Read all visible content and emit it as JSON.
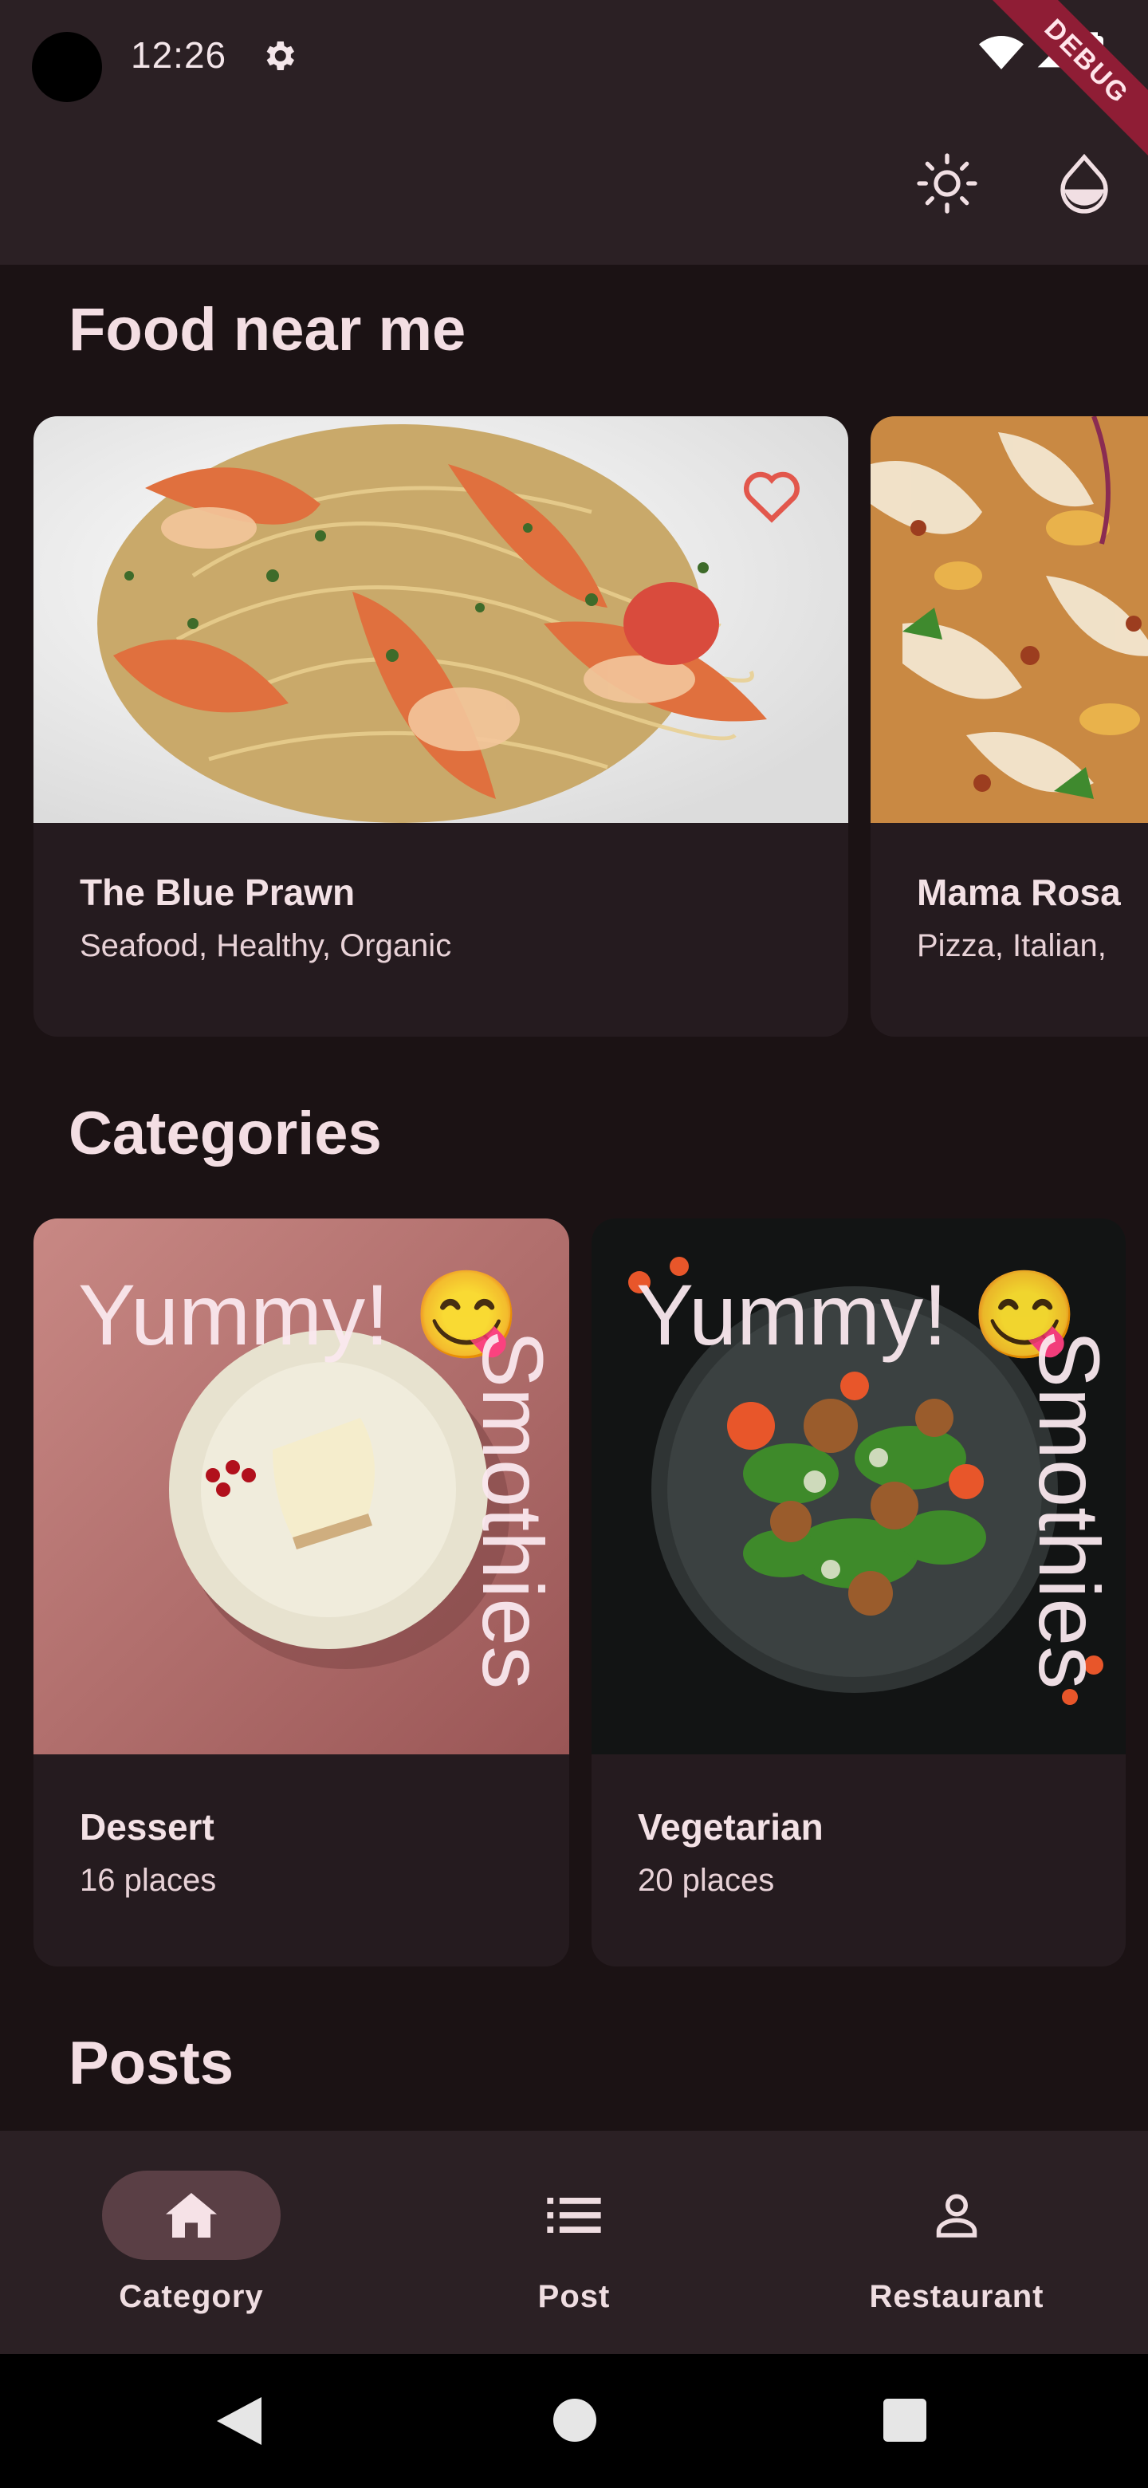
{
  "status_bar": {
    "time": "12:26",
    "debug_banner": "DEBUG"
  },
  "app_bar": {
    "actions": [
      "brightness-icon",
      "color-drop-icon"
    ]
  },
  "sections": {
    "food_near_me": {
      "title": "Food near me",
      "cards": [
        {
          "name": "The Blue Prawn",
          "tags": "Seafood, Healthy, Organic",
          "favorite": true
        },
        {
          "name": "Mama Rosa",
          "tags": "Pizza, Italian,"
        }
      ]
    },
    "categories": {
      "title": "Categories",
      "overlay_text": "Yummy! 😋",
      "overlay_vertical": "Smothies",
      "cards": [
        {
          "name": "Dessert",
          "count": "16 places"
        },
        {
          "name": "Vegetarian",
          "count": "20 places"
        }
      ]
    },
    "posts": {
      "title": "Posts"
    }
  },
  "bottom_nav": {
    "items": [
      {
        "label": "Category",
        "icon": "home-icon",
        "active": true
      },
      {
        "label": "Post",
        "icon": "list-icon",
        "active": false
      },
      {
        "label": "Restaurant",
        "icon": "person-icon",
        "active": false
      }
    ]
  },
  "colors": {
    "accent": "#e2574c",
    "active_pill": "#5a3f45",
    "surface": "#251b1f",
    "background": "#1b1214"
  }
}
